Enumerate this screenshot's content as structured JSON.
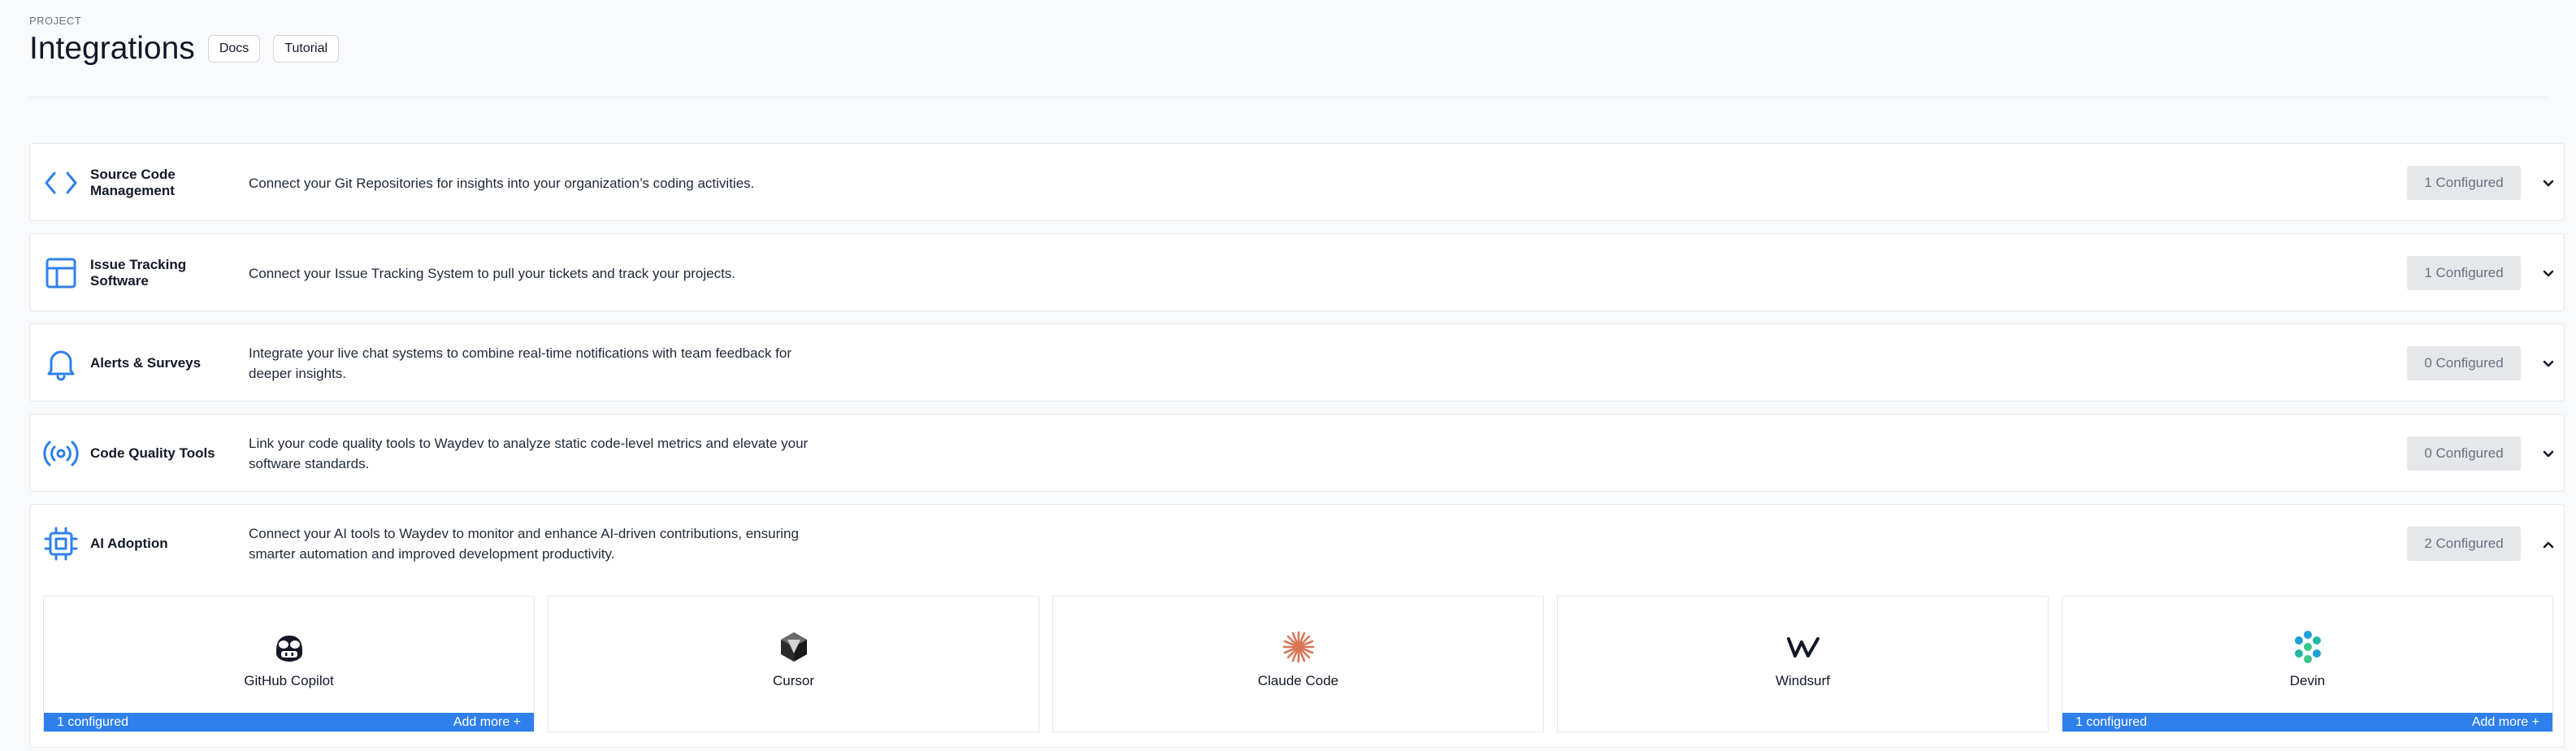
{
  "header": {
    "eyebrow": "PROJECT",
    "title": "Integrations",
    "docs_label": "Docs",
    "tutorial_label": "Tutorial"
  },
  "colors": {
    "accent": "#2f80ed",
    "badge_bg": "#e5e7eb",
    "badge_text": "#6b7280"
  },
  "sections": [
    {
      "name": "Source Code Management",
      "icon": "code-icon",
      "description": "Connect your Git Repositories for insights into your organization’s coding activities.",
      "badge": "1 Configured",
      "expanded": false
    },
    {
      "name": "Issue Tracking Software",
      "icon": "layout-icon",
      "description": "Connect your Issue Tracking System to pull your tickets and track your projects.",
      "badge": "1 Configured",
      "expanded": false
    },
    {
      "name": "Alerts & Surveys",
      "icon": "bell-icon",
      "description": "Integrate your live chat systems to combine real-time notifications with team feedback for deeper insights.",
      "badge": "0 Configured",
      "expanded": false
    },
    {
      "name": "Code Quality Tools",
      "icon": "broadcast-icon",
      "description": "Link your code quality tools to Waydev to analyze static code-level metrics and elevate your software standards.",
      "badge": "0 Configured",
      "expanded": false
    },
    {
      "name": "AI Adoption",
      "icon": "cpu-icon",
      "description": "Connect your AI tools to Waydev to monitor and enhance AI-driven contributions, ensuring smarter automation and improved development productivity.",
      "badge": "2 Configured",
      "expanded": true
    }
  ],
  "ai_tools": [
    {
      "name": "GitHub Copilot",
      "logo": "copilot-logo",
      "configured_label": "1 configured",
      "add_label": "Add more +"
    },
    {
      "name": "Cursor",
      "logo": "cursor-logo"
    },
    {
      "name": "Claude Code",
      "logo": "claude-logo"
    },
    {
      "name": "Windsurf",
      "logo": "windsurf-logo"
    },
    {
      "name": "Devin",
      "logo": "devin-logo",
      "configured_label": "1 configured",
      "add_label": "Add more +"
    }
  ]
}
